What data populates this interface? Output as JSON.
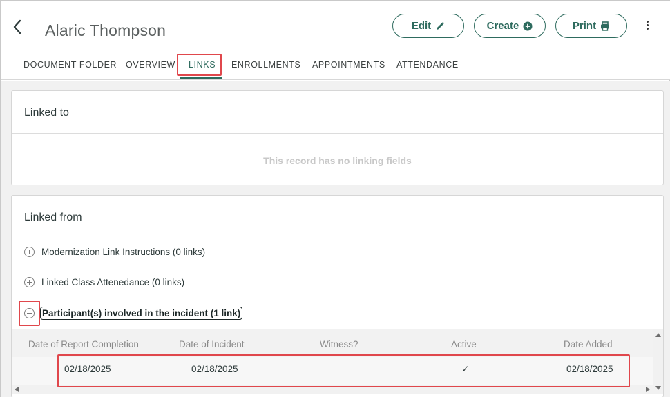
{
  "header": {
    "title": "Alaric Thompson",
    "buttons": {
      "edit": "Edit",
      "create": "Create",
      "print": "Print"
    }
  },
  "tabs": [
    {
      "label": "DOCUMENT FOLDER"
    },
    {
      "label": "OVERVIEW"
    },
    {
      "label": "LINKS"
    },
    {
      "label": "ENROLLMENTS"
    },
    {
      "label": "APPOINTMENTS"
    },
    {
      "label": "ATTENDANCE"
    }
  ],
  "active_tab": "LINKS",
  "linked_to": {
    "title": "Linked to",
    "empty_message": "This record has no linking fields"
  },
  "linked_from": {
    "title": "Linked from",
    "groups": [
      {
        "label": "Modernization Link Instructions (0 links)",
        "expanded": false
      },
      {
        "label": "Linked Class Attenedance (0 links)",
        "expanded": false
      },
      {
        "label": "Participant(s) involved in the incident (1 link)",
        "expanded": true
      }
    ],
    "table": {
      "columns": [
        "Date of Report Completion",
        "Date of Incident",
        "Witness?",
        "Active",
        "Date Added"
      ],
      "rows": [
        [
          "02/18/2025",
          "02/18/2025",
          "",
          "✓",
          "02/18/2025"
        ]
      ]
    }
  },
  "colors": {
    "accent": "#2e6b5e",
    "highlight": "#e0474c"
  },
  "icons": [
    "back-arrow-icon",
    "pencil-icon",
    "plus-circle-icon",
    "printer-icon",
    "more-vertical-icon",
    "expand-icon",
    "collapse-icon",
    "check-icon"
  ]
}
